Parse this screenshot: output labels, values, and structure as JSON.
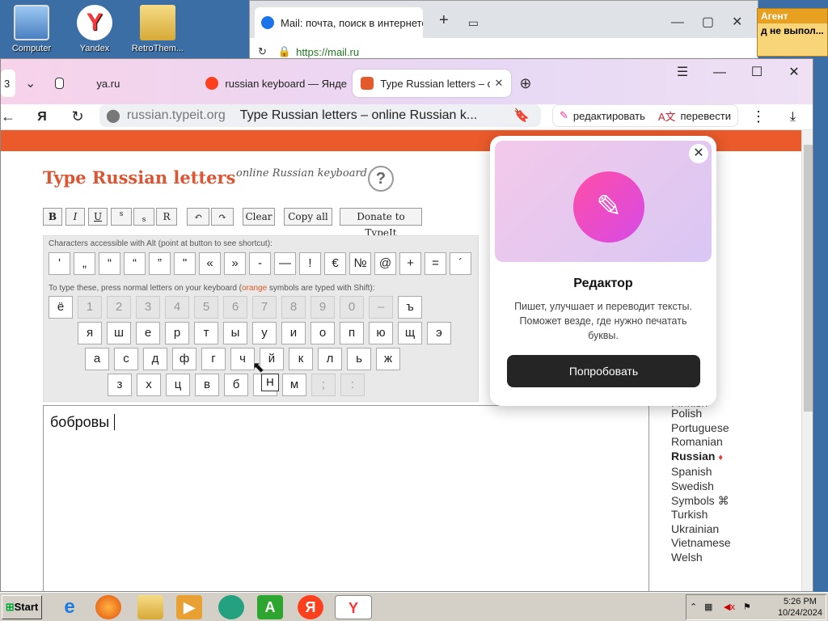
{
  "desktop": {
    "icons": [
      {
        "label": "Computer"
      },
      {
        "label": "Yandex"
      },
      {
        "label": "RetroThem..."
      }
    ],
    "agent": {
      "title": "Агент",
      "message": "д не выпол..."
    }
  },
  "bg_browser": {
    "tab_title": "Mail: почта, поиск в интернете",
    "url": "https://mail.ru"
  },
  "browser": {
    "tab_counter": "3",
    "tabs": [
      {
        "label": "ya.ru"
      },
      {
        "label": "russian keyboard — Янде"
      },
      {
        "label": "Type Russian letters – o"
      }
    ],
    "address": {
      "host": "russian.typeit.org",
      "title": "Type Russian letters – online Russian k..."
    },
    "tools": {
      "edit": "редактировать",
      "translate": "перевести"
    }
  },
  "site": {
    "title": "Type Russian letters",
    "subtitle": "online Russian keyboard",
    "help": "?",
    "toolbar": {
      "b": "B",
      "i": "I",
      "u": "U",
      "sup": "s",
      "sub": "s",
      "r": "R",
      "undo": "↶",
      "redo": "↷",
      "clear": "Clear",
      "copy_all": "Copy all",
      "donate": "Donate to TypeIt"
    },
    "alt_note": "Characters accessible with Alt (point at button to see shortcut):",
    "shift_note_pre": "To type these, press normal letters on your keyboard (",
    "shift_note_orange": "orange",
    "shift_note_post": " symbols are typed with Shift):",
    "symbols": [
      "'",
      "„",
      "“",
      "“",
      "”",
      "\"",
      "«",
      "»",
      "-",
      "—",
      "!",
      "€",
      "№",
      "@",
      "+",
      "=",
      "´"
    ],
    "row_digits": [
      "ё",
      "1",
      "2",
      "3",
      "4",
      "5",
      "6",
      "7",
      "8",
      "9",
      "0",
      "–",
      "ъ"
    ],
    "row1": [
      "я",
      "ш",
      "е",
      "р",
      "т",
      "ы",
      "у",
      "и",
      "о",
      "п",
      "ю",
      "щ",
      "э"
    ],
    "row2": [
      "а",
      "с",
      "д",
      "ф",
      "г",
      "ч",
      "й",
      "к",
      "л",
      "ь",
      "ж"
    ],
    "row3": [
      "з",
      "х",
      "ц",
      "в",
      "б",
      "н",
      "м",
      ";",
      ":"
    ],
    "editor_text": "бобровы",
    "tooltip": "Н",
    "sidebar_fragments": [
      "s",
      "h"
    ],
    "languages": [
      "Finnish",
      "Polish",
      "Portuguese",
      "Romanian",
      "Russian",
      "Spanish",
      "Swedish",
      "Symbols ⌘",
      "Turkish",
      "Ukrainian",
      "Vietnamese",
      "Welsh"
    ],
    "current_language_marker": "♦"
  },
  "popup": {
    "title": "Редактор",
    "description": "Пишет, улучшает и переводит тексты. Поможет везде, где нужно печатать буквы.",
    "button": "Попробовать",
    "close": "✕"
  },
  "taskbar": {
    "start": "Start",
    "time": "5:26 PM",
    "date": "10/24/2024"
  }
}
